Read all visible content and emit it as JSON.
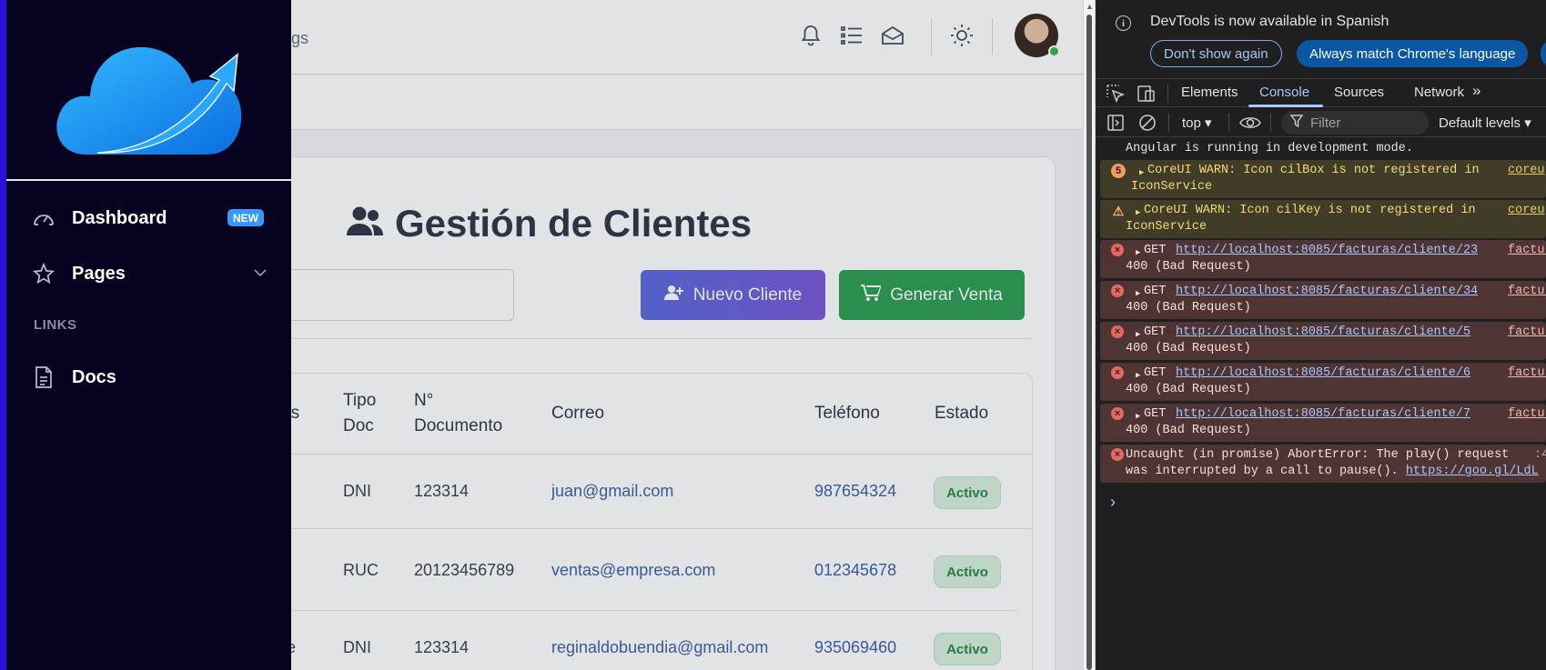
{
  "header": {
    "crumb_partial": "gs",
    "icons": [
      "bell-icon",
      "list-icon",
      "envelope-icon",
      "sun-icon"
    ]
  },
  "sidebar": {
    "items": [
      {
        "label": "Dashboard",
        "icon": "speedometer-icon",
        "badge": "NEW"
      },
      {
        "label": "Pages",
        "icon": "star-icon"
      }
    ],
    "links_title": "LINKS",
    "links": [
      {
        "label": "Docs",
        "icon": "document-icon"
      }
    ],
    "accent": "#2b10e0"
  },
  "main": {
    "title": "Gestión de Clientes",
    "buttons": {
      "nuevo": "Nuevo Cliente",
      "venta": "Generar Venta"
    },
    "table": {
      "headers": {
        "apellidos_partial": "os",
        "tipo_doc": "Tipo Doc",
        "tipo_doc_l1": "Tipo",
        "tipo_doc_l2": "Doc",
        "num_doc_l1": "N°",
        "num_doc_l2": "Documento",
        "correo": "Correo",
        "telefono": "Teléfono",
        "estado": "Estado"
      },
      "rows": [
        {
          "name_partial": "",
          "tipo": "DNI",
          "numero": "123314",
          "correo": "juan@gmail.com",
          "telefono": "987654324",
          "estado": "Activo"
        },
        {
          "name_partial": "",
          "tipo": "RUC",
          "numero": "20123456789",
          "correo": "ventas@empresa.com",
          "telefono": "012345678",
          "estado": "Activo"
        },
        {
          "name_partial": "re",
          "tipo": "DNI",
          "numero": "123314",
          "correo": "reginaldobuendia@gmail.com",
          "telefono": "935069460",
          "estado": "Activo"
        }
      ]
    }
  },
  "devtools": {
    "info": {
      "text": "DevTools is now available in Spanish",
      "dont_show": "Don't show again",
      "always_match": "Always match Chrome's language"
    },
    "tabs": [
      "Elements",
      "Console",
      "Sources",
      "Network"
    ],
    "active_tab": "Console",
    "context": "top",
    "filter_placeholder": "Filter",
    "levels": "Default levels",
    "messages": [
      {
        "type": "plain",
        "text": "Angular is running in development mode."
      },
      {
        "type": "warn",
        "count": "5",
        "line1": "CoreUI WARN: Icon cilBox is not registered in",
        "line2": "IconService",
        "source": "coreu"
      },
      {
        "type": "warn",
        "line1": "CoreUI WARN: Icon cilKey is not registered in",
        "line2": "IconService",
        "source": "coreu"
      },
      {
        "type": "err",
        "method": "GET",
        "url": "http://localhost:8085/facturas/cliente/23",
        "status": "400 (Bad Request)",
        "source": "factur"
      },
      {
        "type": "err",
        "method": "GET",
        "url": "http://localhost:8085/facturas/cliente/34",
        "status": "400 (Bad Request)",
        "source": "factur"
      },
      {
        "type": "err",
        "method": "GET",
        "url": "http://localhost:8085/facturas/cliente/5",
        "status": "400 (Bad Request)",
        "source": "factur"
      },
      {
        "type": "err",
        "method": "GET",
        "url": "http://localhost:8085/facturas/cliente/6",
        "status": "400 (Bad Request)",
        "source": "factur"
      },
      {
        "type": "err",
        "method": "GET",
        "url": "http://localhost:8085/facturas/cliente/7",
        "status": "400 (Bad Request)",
        "source": "factur"
      },
      {
        "type": "err",
        "line1": "Uncaught (in promise) AbortError: The play() request",
        "line2_pre": "was interrupted by a call to pause(). ",
        "link": "https://goo.gl/LdL",
        "source": ":4"
      }
    ],
    "prompt": "›"
  }
}
